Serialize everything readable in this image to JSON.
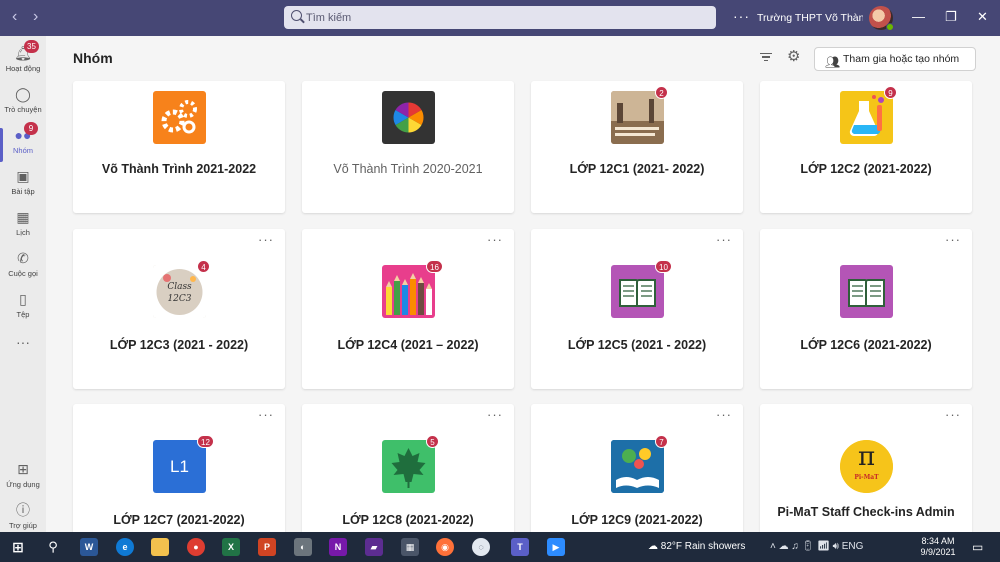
{
  "titlebar": {
    "back_icon": "chevron-left-icon",
    "forward_icon": "chevron-right-icon",
    "search_placeholder": "Tìm kiếm",
    "more_label": "···",
    "org_name": "Trường THPT Võ Thành T...",
    "bg_color": "#464775"
  },
  "rail": {
    "items": [
      {
        "label": "Hoạt động",
        "icon": "bell-icon",
        "badge": "35"
      },
      {
        "label": "Trò chuyện",
        "icon": "chat-icon",
        "badge": ""
      },
      {
        "label": "Nhóm",
        "icon": "teams-icon",
        "badge": "9"
      },
      {
        "label": "Bài tập",
        "icon": "assignments-icon",
        "badge": ""
      },
      {
        "label": "Lịch",
        "icon": "calendar-icon",
        "badge": ""
      },
      {
        "label": "Cuộc gọi",
        "icon": "phone-icon",
        "badge": ""
      },
      {
        "label": "Tệp",
        "icon": "file-icon",
        "badge": ""
      },
      {
        "label": "Ứng dụng",
        "icon": "apps-icon",
        "badge": ""
      },
      {
        "label": "Trợ giúp",
        "icon": "help-icon",
        "badge": ""
      }
    ],
    "more_label": "···"
  },
  "header": {
    "title": "Nhóm",
    "join_button": "Tham gia hoặc tạo nhóm"
  },
  "teams": [
    {
      "name": "Võ Thành Trình 2021-2022",
      "badge": "",
      "logo": "gears-icon",
      "color": "#f7821b"
    },
    {
      "name": "Võ Thành Trình 2020-2021",
      "badge": "",
      "logo": "color-wheel-icon",
      "color": "#333333"
    },
    {
      "name": "LỚP 12C1 (2021- 2022)",
      "badge": "2",
      "logo": "photo-icon",
      "color": "#b89a76"
    },
    {
      "name": "LỚP 12C2 (2021-2022)",
      "badge": "9",
      "logo": "flask-icon",
      "color": "#f5c518"
    },
    {
      "name": "LỚP 12C3 (2021 - 2022)",
      "badge": "4",
      "logo": "sticker-icon",
      "color": "#d9cfc2"
    },
    {
      "name": "LỚP 12C4 (2021 – 2022)",
      "badge": "16",
      "logo": "pencils-icon",
      "color": "#e83e8c"
    },
    {
      "name": "LỚP 12C5 (2021 - 2022)",
      "badge": "10",
      "logo": "book-icon",
      "color": "#b455b6"
    },
    {
      "name": "LỚP 12C6 (2021-2022)",
      "badge": "",
      "logo": "book-icon",
      "color": "#b455b6"
    },
    {
      "name": "LỚP 12C7 (2021-2022)",
      "badge": "12",
      "logo": "initials-icon",
      "logo_text": "L1",
      "color": "#2b6fd6"
    },
    {
      "name": "LỚP 12C8 (2021-2022)",
      "badge": "5",
      "logo": "maple-leaf-icon",
      "color": "#3fbf6a"
    },
    {
      "name": "LỚP 12C9 (2021-2022)",
      "badge": "7",
      "logo": "open-book-icon",
      "color": "#1d6fa8"
    },
    {
      "name": "Pi-MaT Staff Check-ins Admin",
      "badge": "",
      "logo": "pi-icon",
      "logo_text": "π",
      "logo_sub": "Pi-MaT",
      "color": "#f6c41a"
    }
  ],
  "taskbar": {
    "weather": "82°F  Rain showers",
    "language": "ENG",
    "time": "8:34 AM",
    "date": "9/9/2021",
    "bg_color": "#1f2a3c"
  }
}
